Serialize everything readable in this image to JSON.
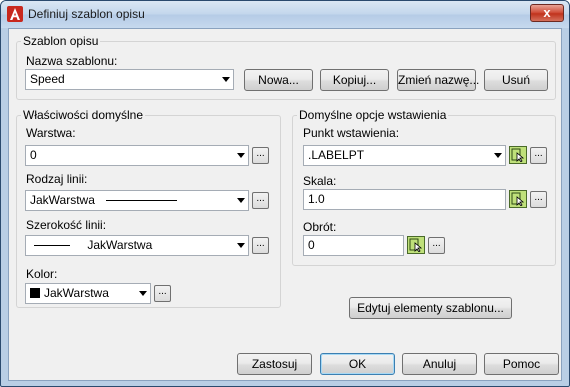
{
  "window": {
    "title": "Definiuj szablon opisu",
    "close_label": "x"
  },
  "template_group": {
    "legend": "Szablon opisu",
    "name_label": "Nazwa szablonu:",
    "name_value": "Speed",
    "buttons": {
      "new": "Nowa...",
      "copy": "Kopiuj...",
      "rename": "Zmień nazwę...",
      "delete": "Usuń"
    }
  },
  "defaults_group": {
    "legend": "Właściwości domyślne",
    "layer_label": "Warstwa:",
    "layer_value": "0",
    "linetype_label": "Rodzaj linii:",
    "linetype_value": "JakWarstwa",
    "lineweight_label": "Szerokość linii:",
    "lineweight_value": "JakWarstwa",
    "color_label": "Kolor:",
    "color_value": "JakWarstwa",
    "color_swatch": "#000000",
    "browse": "..."
  },
  "insert_group": {
    "legend": "Domyślne opcje wstawienia",
    "point_label": "Punkt wstawienia:",
    "point_value": ".LABELPT",
    "scale_label": "Skala:",
    "scale_value": "1.0",
    "rotation_label": "Obrót:",
    "rotation_value": "0",
    "browse": "..."
  },
  "edit_elements_button": "Edytuj elementy szablonu...",
  "footer": {
    "apply": "Zastosuj",
    "ok": "OK",
    "cancel": "Anuluj",
    "help": "Pomoc"
  }
}
